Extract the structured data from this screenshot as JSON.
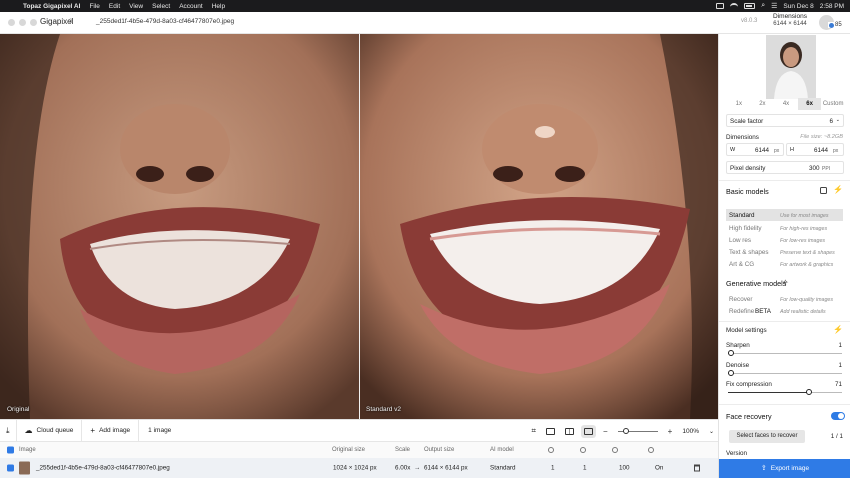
{
  "menubar": {
    "app_name": "Topaz Gigapixel AI",
    "items": [
      "File",
      "Edit",
      "View",
      "Select",
      "Account",
      "Help"
    ],
    "clock_date": "Sun Dec 8",
    "clock_time": "2:58 PM"
  },
  "header": {
    "app_title": "Gigapixel",
    "app_version_badge": "8",
    "filename": "_255ded1f-4b5e-479d-8a03-cf46477807e0.jpeg",
    "version": "v8.0.3",
    "dimensions_label": "Dimensions",
    "dimensions_value": "6144 × 6144",
    "credits": "85"
  },
  "viewer": {
    "left_label": "Original",
    "right_label": "Standard v2"
  },
  "toolbar": {
    "cloud_queue": "Cloud queue",
    "add_image": "Add image",
    "image_count": "1 image",
    "zoom_minus": "−",
    "zoom_plus": "+",
    "zoom_level": "100%"
  },
  "queue": {
    "headers": {
      "image": "Image",
      "original_size": "Original size",
      "scale": "Scale",
      "output_size": "Output size",
      "ai_model": "AI model"
    },
    "row": {
      "filename": "_255ded1f-4b5e-479d-8a03-cf46477807e0.jpeg",
      "original_size": "1024 × 1024 px",
      "scale": "6.00x",
      "arrow": "→",
      "output_size": "6144 × 6144 px",
      "ai_model": "Standard",
      "v1": "1",
      "v2": "1",
      "v3": "100",
      "v4": "On"
    }
  },
  "sidebar": {
    "scale_options": [
      "1x",
      "2x",
      "4x",
      "6x",
      "Custom"
    ],
    "scale_selected": "6x",
    "scale_factor_label": "Scale factor",
    "scale_factor_value": "6",
    "dimensions_label": "Dimensions",
    "file_size": "File size: ~8.2GB",
    "w_label": "W",
    "w_value": "6144",
    "w_unit": "px",
    "h_label": "H",
    "h_value": "6144",
    "h_unit": "px",
    "pixel_density_label": "Pixel density",
    "pixel_density_value": "300",
    "pixel_density_unit": "PPI",
    "basic_models_title": "Basic models",
    "basic_models": [
      {
        "name": "Standard",
        "desc": "Use for most images",
        "selected": true
      },
      {
        "name": "High fidelity",
        "desc": "For high-res images",
        "selected": false
      },
      {
        "name": "Low res",
        "desc": "For low-res images",
        "selected": false
      },
      {
        "name": "Text & shapes",
        "desc": "Preserve text & shapes",
        "selected": false
      },
      {
        "name": "Art & CG",
        "desc": "For artwork & graphics",
        "selected": false
      }
    ],
    "generative_models_title": "Generative models",
    "generative_models": [
      {
        "name": "Recover",
        "desc": "For low-quality images"
      },
      {
        "name": "Redefine",
        "badge": "BETA",
        "desc": "Add realistic details"
      }
    ],
    "model_settings_title": "Model settings",
    "sharpen_label": "Sharpen",
    "sharpen_value": "1",
    "sharpen_fraction": 0.0,
    "denoise_label": "Denoise",
    "denoise_value": "1",
    "denoise_fraction": 0.0,
    "fix_compression_label": "Fix compression",
    "fix_compression_value": "71",
    "fix_compression_fraction": 0.71,
    "face_recovery_title": "Face recovery",
    "face_recovery_on": true,
    "select_faces_button": "Select faces to recover",
    "faces_count": "1 / 1",
    "version_label": "Version",
    "export_button": "Export image"
  },
  "colors": {
    "accent": "#2f7be6",
    "menubar": "#1b1b1d"
  }
}
